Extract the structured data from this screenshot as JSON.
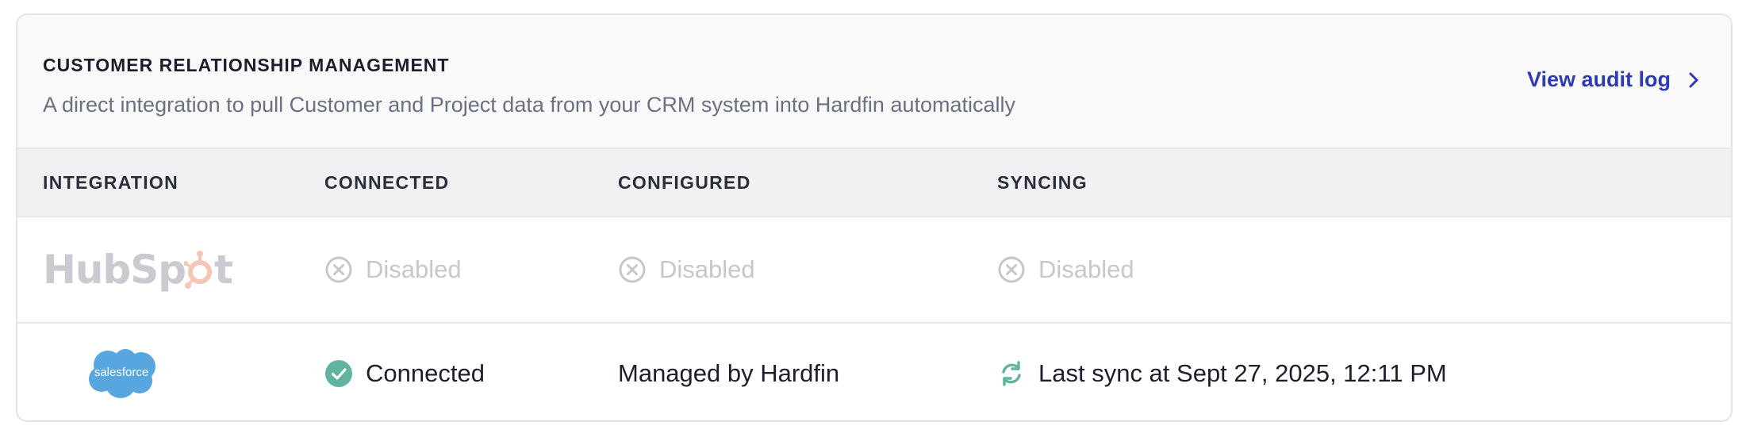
{
  "header": {
    "title": "CUSTOMER RELATIONSHIP MANAGEMENT",
    "description": "A direct integration to pull Customer and Project data from your CRM system into Hardfin automatically",
    "audit_link_label": "View audit log"
  },
  "table": {
    "columns": [
      "INTEGRATION",
      "CONNECTED",
      "CONFIGURED",
      "SYNCING"
    ],
    "rows": [
      {
        "integration_logo": "HubSpot",
        "integration_icon": "hubspot-logo",
        "connected": "Disabled",
        "configured": "Disabled",
        "syncing": "Disabled",
        "status_icon": "x-circle-icon"
      },
      {
        "integration_logo": "salesforce",
        "integration_icon": "salesforce-cloud-logo",
        "connected": "Connected",
        "connected_icon": "check-circle-icon",
        "configured": "Managed by Hardfin",
        "syncing": "Last sync at Sept 27, 2025, 12:11 PM",
        "syncing_icon": "sync-icon"
      }
    ]
  },
  "colors": {
    "accent_link": "#2d3cb5",
    "success": "#5fb3a0",
    "disabled": "#c5c7cd",
    "salesforce_blue": "#58a6e0",
    "hubspot_orange": "#f5c6b5"
  }
}
